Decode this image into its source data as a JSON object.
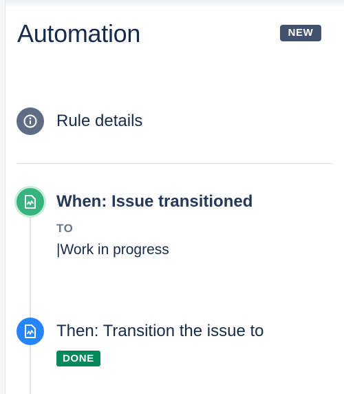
{
  "header": {
    "title": "Automation",
    "badge": "NEW"
  },
  "rule_details": {
    "label": "Rule details",
    "icon": "info-icon"
  },
  "trigger": {
    "label": "When: Issue transitioned",
    "to_label": "TO",
    "status": "|Work in progress",
    "icon": "component-file-icon",
    "color": "#36b37e"
  },
  "action": {
    "label": "Then: Transition the issue to",
    "status_lozenge": "DONE",
    "status_color": "#00875a",
    "icon": "component-file-icon",
    "color": "#2684ff"
  },
  "colors": {
    "primary_text": "#172b4d",
    "badge_bg": "#42526e",
    "divider": "#dfe1e6"
  }
}
